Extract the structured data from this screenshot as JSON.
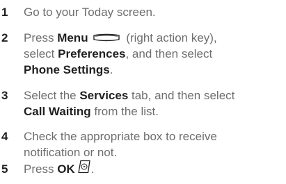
{
  "steps": [
    {
      "number": "1",
      "text_before": "Go to your Today screen."
    },
    {
      "number": "2",
      "press": "Press ",
      "menu": "Menu",
      "after_menu_icon": " (right action key),",
      "line2_before": "select ",
      "preferences": "Preferences",
      "line2_after": ", and then select",
      "phone_settings": "Phone Settings",
      "period": "."
    },
    {
      "number": "3",
      "text_before": "Select the ",
      "services": "Services",
      "text_after": " tab, and then select",
      "call_waiting": "Call Waiting",
      "text_end": " from the list."
    },
    {
      "number": "4",
      "line1": "Check the appropriate box to receive",
      "line2": "notification or not."
    },
    {
      "number": "5",
      "press": "Press ",
      "ok": "OK",
      "period": "."
    }
  ],
  "icons": {
    "menu_key": "right-action-key-icon",
    "ok_key": "ok-key-icon"
  }
}
